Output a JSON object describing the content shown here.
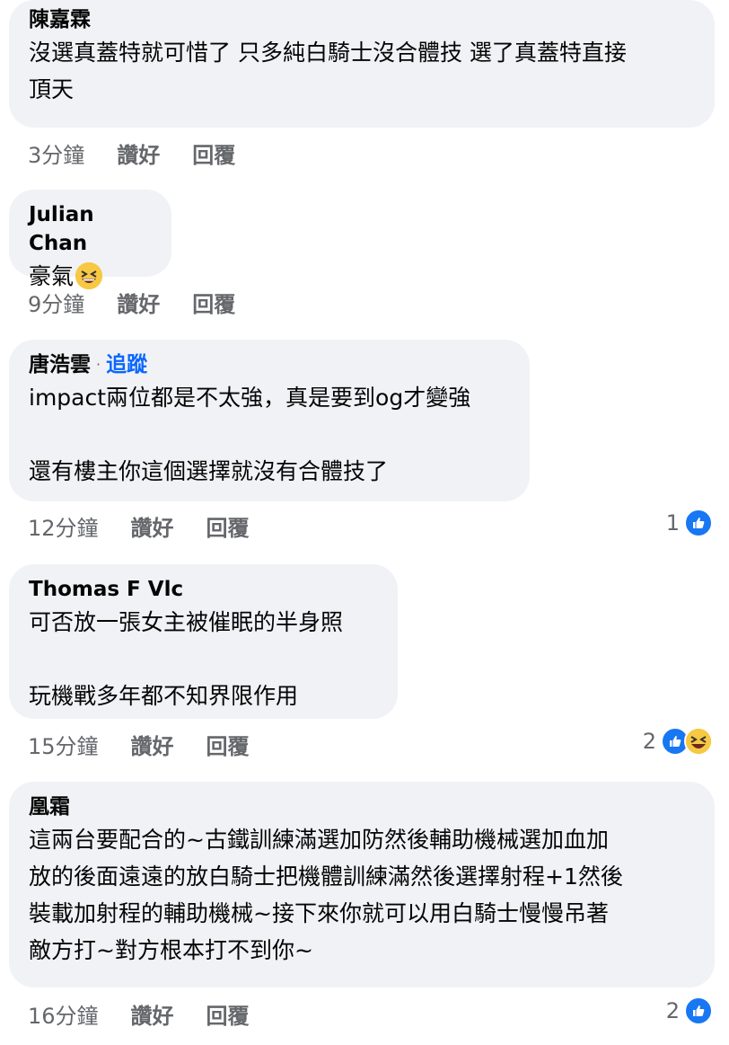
{
  "comments": [
    {
      "author": "陳嘉霖",
      "lines": [
        "沒選真蓋特就可惜了 只多純白騎士沒合體技 選了真蓋特直接",
        "頂天"
      ],
      "time": "3分鐘",
      "like_label": "讚好",
      "reply_label": "回覆"
    },
    {
      "author": "Julian Chan",
      "lines": [
        "豪氣"
      ],
      "emoji": "grinning-squinting-face-icon",
      "time": "9分鐘",
      "like_label": "讚好",
      "reply_label": "回覆"
    },
    {
      "author": "唐浩雲",
      "follow_sep": "·",
      "follow_label": "追蹤",
      "lines": [
        "impact兩位都是不太強，真是要到og才變強",
        "",
        "還有樓主你這個選擇就沒有合體技了"
      ],
      "time": "12分鐘",
      "like_label": "讚好",
      "reply_label": "回覆",
      "reaction_count": "1",
      "reactions": [
        "like-reaction-icon"
      ]
    },
    {
      "author": "Thomas F Vlc",
      "lines": [
        "可否放一張女主被催眠的半身照",
        "",
        "玩機戰多年都不知界限作用"
      ],
      "time": "15分鐘",
      "like_label": "讚好",
      "reply_label": "回覆",
      "reaction_count": "2",
      "reactions": [
        "like-reaction-icon",
        "haha-reaction-icon"
      ]
    },
    {
      "author": "凰霜",
      "lines": [
        "這兩台要配合的~古鐵訓練滿選加防然後輔助機械選加血加",
        "放的後面遠遠的放白騎士把機體訓練滿然後選擇射程+1然後",
        "裝載加射程的輔助機械~接下來你就可以用白騎士慢慢吊著",
        "敵方打~對方根本打不到你~"
      ],
      "time": "16分鐘",
      "like_label": "讚好",
      "reply_label": "回覆",
      "reaction_count": "2",
      "reactions": [
        "like-reaction-icon"
      ]
    }
  ],
  "colors": {
    "bubble": "#f0f2f5",
    "meta_text": "#65676b",
    "follow_link": "#0866ff",
    "like_blue": "#1877f2",
    "haha_yellow": "#f7c843"
  }
}
